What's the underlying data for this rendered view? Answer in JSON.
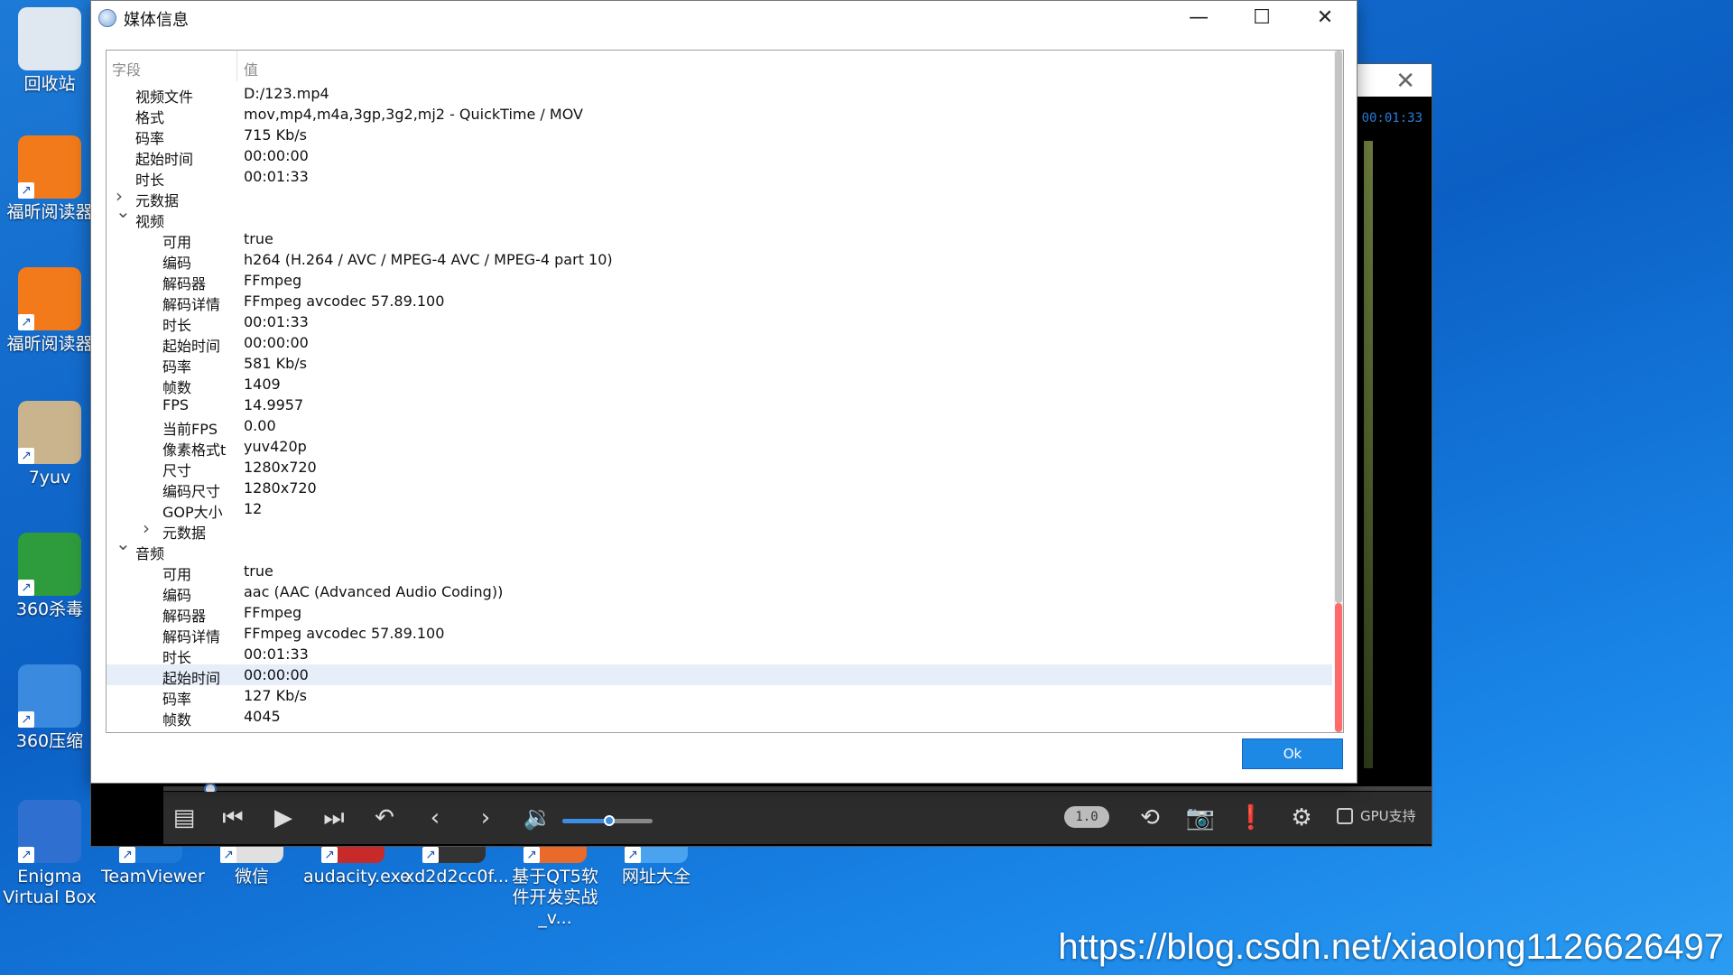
{
  "desktop": {
    "icons": [
      {
        "name": "recycle-bin",
        "label": "回收站",
        "color": "#dfe8f0"
      },
      {
        "name": "foxit-reader-1",
        "label": "福昕阅读器",
        "color": "#f27a1a"
      },
      {
        "name": "foxit-reader-2",
        "label": "福昕阅读器",
        "color": "#f27a1a"
      },
      {
        "name": "7yuv",
        "label": "7yuv",
        "color": "#c9b48e"
      },
      {
        "name": "360-antivirus",
        "label": "360杀毒",
        "color": "#2e9b3d"
      },
      {
        "name": "360-zip",
        "label": "360压缩",
        "color": "#3a8be0"
      },
      {
        "name": "enigma-virtual-box",
        "label": "Enigma Virtual Box",
        "color": "#2f6fd0"
      },
      {
        "name": "teamviewer",
        "label": "TeamViewer",
        "color": "#1c79d9"
      },
      {
        "name": "wechat",
        "label": "微信",
        "color": "#e0e0e0"
      },
      {
        "name": "audacity",
        "label": "audacity.exe",
        "color": "#c82a2a"
      },
      {
        "name": "xd2d2cc0f",
        "label": "xd2d2cc0f...",
        "color": "#333333"
      },
      {
        "name": "qt5-book",
        "label": "基于QT5软件开发实战_v...",
        "color": "#e96a2a"
      },
      {
        "name": "web-directory",
        "label": "网址大全",
        "color": "#4aa3ef"
      }
    ],
    "watermark": "https://blog.csdn.net/xiaolong1126626497"
  },
  "player": {
    "time": "00:01:33",
    "speed": "1.0",
    "gpu_label": "GPU支持"
  },
  "dialog": {
    "title": "媒体信息",
    "header_field": "字段",
    "header_value": "值",
    "ok_label": "Ok",
    "rows": [
      {
        "f": "视频文件",
        "v": "D:/123.mp4",
        "lvl": 1
      },
      {
        "f": "格式",
        "v": "mov,mp4,m4a,3gp,3g2,mj2 - QuickTime / MOV",
        "lvl": 1
      },
      {
        "f": "码率",
        "v": "715 Kb/s",
        "lvl": 1
      },
      {
        "f": "起始时间",
        "v": "00:00:00",
        "lvl": 1
      },
      {
        "f": "时长",
        "v": "00:01:33",
        "lvl": 1
      },
      {
        "f": "元数据",
        "v": "",
        "lvl": 1,
        "exp": "collapsed"
      },
      {
        "f": "视频",
        "v": "",
        "lvl": 1,
        "exp": "expanded"
      },
      {
        "f": "可用",
        "v": "true",
        "lvl": 2
      },
      {
        "f": "编码",
        "v": "h264 (H.264 / AVC / MPEG-4 AVC / MPEG-4 part 10)",
        "lvl": 2
      },
      {
        "f": "解码器",
        "v": "FFmpeg",
        "lvl": 2
      },
      {
        "f": "解码详情",
        "v": "FFmpeg avcodec 57.89.100",
        "lvl": 2
      },
      {
        "f": "时长",
        "v": "00:01:33",
        "lvl": 2
      },
      {
        "f": "起始时间",
        "v": "00:00:00",
        "lvl": 2
      },
      {
        "f": "码率",
        "v": "581 Kb/s",
        "lvl": 2
      },
      {
        "f": "帧数",
        "v": "1409",
        "lvl": 2
      },
      {
        "f": "FPS",
        "v": "14.9957",
        "lvl": 2
      },
      {
        "f": "当前FPS",
        "v": "0.00",
        "lvl": 2
      },
      {
        "f": "像素格式t",
        "v": "yuv420p",
        "lvl": 2
      },
      {
        "f": "尺寸",
        "v": "1280x720",
        "lvl": 2
      },
      {
        "f": "编码尺寸",
        "v": "1280x720",
        "lvl": 2
      },
      {
        "f": "GOP大小",
        "v": "12",
        "lvl": 2
      },
      {
        "f": "元数据",
        "v": "",
        "lvl": 2,
        "exp": "collapsed"
      },
      {
        "f": "音频",
        "v": "",
        "lvl": 1,
        "exp": "expanded"
      },
      {
        "f": "可用",
        "v": "true",
        "lvl": 2
      },
      {
        "f": "编码",
        "v": "aac (AAC (Advanced Audio Coding))",
        "lvl": 2
      },
      {
        "f": "解码器",
        "v": "FFmpeg",
        "lvl": 2
      },
      {
        "f": "解码详情",
        "v": "FFmpeg avcodec 57.89.100",
        "lvl": 2
      },
      {
        "f": "时长",
        "v": "00:01:33",
        "lvl": 2
      },
      {
        "f": "起始时间",
        "v": "00:00:00",
        "lvl": 2,
        "selected": true
      },
      {
        "f": "码率",
        "v": "127 Kb/s",
        "lvl": 2
      },
      {
        "f": "帧数",
        "v": "4045",
        "lvl": 2
      }
    ]
  }
}
